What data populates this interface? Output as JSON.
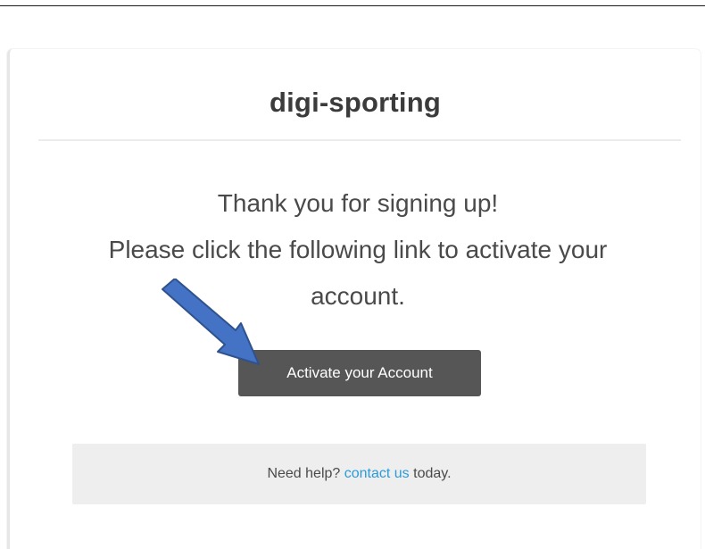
{
  "email": {
    "brand_title": "digi-sporting",
    "message_line1": "Thank you for signing up!",
    "message_line2": "Please click the following link to activate your",
    "message_line3": "account.",
    "activate_button_label": "Activate your Account",
    "help_prefix": "Need help?",
    "help_link_label": "contact us",
    "help_suffix": "today."
  },
  "annotation": {
    "icon": "arrow-pointer-icon",
    "color": "#4472c4",
    "stroke_color": "#2f528f"
  },
  "colors": {
    "button_bg": "#565656",
    "link": "#2a9bd8",
    "help_bg": "#eeeeee"
  }
}
